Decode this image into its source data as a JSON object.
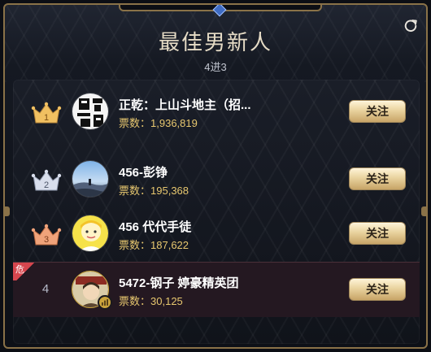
{
  "header": {
    "title": "最佳男新人",
    "subtitle": "4进3",
    "refresh_icon": "refresh-icon"
  },
  "colors": {
    "gold_accent": "#e7c76f",
    "border_gold": "#8a7248",
    "danger_red": "#d6464e",
    "crown_gold": "#f1c061",
    "crown_silver": "#cfd6e6",
    "crown_bronze": "#f0a37a"
  },
  "ranking": [
    {
      "rank": "1",
      "name": "正乾：上山斗地主（招...",
      "votes_label": "票数：",
      "votes": "1,936,819",
      "follow_label": "关注",
      "crown": "gold"
    },
    {
      "rank": "2",
      "name": "456-彭铮",
      "votes_label": "票数：",
      "votes": "195,368",
      "follow_label": "关注",
      "crown": "silver"
    },
    {
      "rank": "3",
      "name": "456 代代手徒",
      "votes_label": "票数：",
      "votes": "187,622",
      "follow_label": "关注",
      "crown": "bronze"
    },
    {
      "rank": "4",
      "name": "5472-钢子 婷豪精英团",
      "votes_label": "票数：",
      "votes": "30,125",
      "follow_label": "关注",
      "danger_label": "危"
    }
  ]
}
